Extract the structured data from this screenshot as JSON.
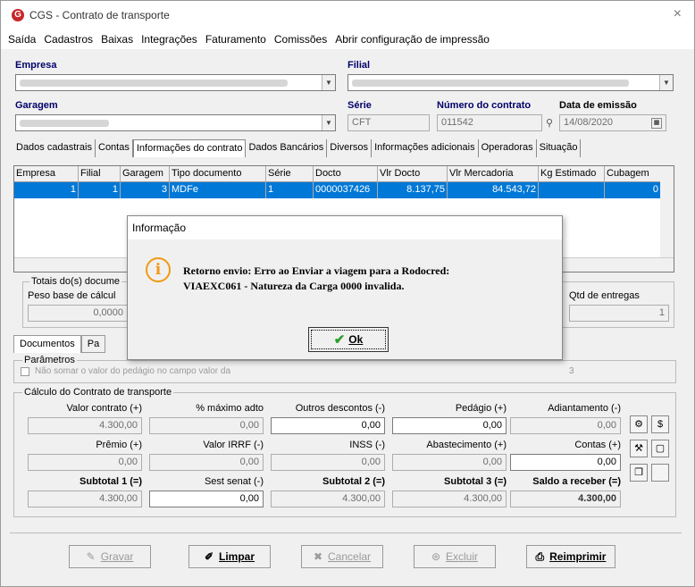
{
  "window": {
    "title": "CGS - Contrato de transporte",
    "logo": "G",
    "close_icon": "×"
  },
  "menu": [
    "Saída",
    "Cadastros",
    "Baixas",
    "Integrações",
    "Faturamento",
    "Comissões",
    "Abrir configuração de impressão"
  ],
  "fields": {
    "empresa_label": "Empresa",
    "filial_label": "Filial",
    "garagem_label": "Garagem",
    "serie_label": "Série",
    "serie_value": "CFT",
    "numero_label": "Número do contrato",
    "numero_value": "011542",
    "data_label": "Data de emissão",
    "data_value": "14/08/2020"
  },
  "tabs": [
    "Dados cadastrais",
    "Contas",
    "Informações do contrato",
    "Dados Bancários",
    "Diversos",
    "Informações adicionais",
    "Operadoras",
    "Situação"
  ],
  "grid": {
    "headers": [
      "Empresa",
      "Filial",
      "Garagem",
      "Tipo documento",
      "Série",
      "Docto",
      "Vlr Docto",
      "Vlr Mercadoria",
      "Kg Estimado",
      "Cubagem"
    ],
    "row": [
      "1",
      "1",
      "3",
      "MDFe",
      "1",
      "0000037426",
      "8.137,75",
      "84.543,72",
      "",
      "0"
    ]
  },
  "totals": {
    "group": "Totais do(s) docume",
    "peso_label": "Peso base de cálcul",
    "peso_value": "0,0000",
    "entregas_label": "Qtd de entregas",
    "entregas_value": "1"
  },
  "bottom_tabs": [
    "Documentos",
    "Pa"
  ],
  "params": {
    "group": "Parâmetros",
    "text": "Não somar o valor do pedágio no campo valor da",
    "tail": "3"
  },
  "calc": {
    "group": "Cálculo do Contrato de transporte",
    "row1_labels": [
      "Valor contrato (+)",
      "% máximo adto",
      "Outros descontos (-)",
      "Pedágio (+)",
      "Adiantamento (-)"
    ],
    "row1_values": [
      "4.300,00",
      "0,00",
      "0,00",
      "0,00",
      "0,00"
    ],
    "row2_labels": [
      "Prêmio (+)",
      "Valor IRRF (-)",
      "INSS (-)",
      "Abastecimento (+)",
      "Contas (+)"
    ],
    "row2_values": [
      "0,00",
      "0,00",
      "0,00",
      "0,00",
      "0,00"
    ],
    "row3_labels": [
      "Subtotal 1 (=)",
      "Sest senat (-)",
      "Subtotal 2 (=)",
      "Subtotal 3 (=)",
      "Saldo a receber (=)"
    ],
    "row3_values": [
      "4.300,00",
      "0,00",
      "4.300,00",
      "4.300,00",
      "4.300,00"
    ]
  },
  "buttons": {
    "gravar": "Gravar",
    "limpar": "Limpar",
    "cancelar": "Cancelar",
    "excluir": "Excluir",
    "reimprimir": "Reimprimir"
  },
  "dialog": {
    "title": "Informação",
    "icon": "i",
    "line1": "Retorno envio: Erro ao Enviar a viagem para a Rodocred:",
    "line2": "VIAEXC061 - Natureza da Carga 0000 invalida.",
    "ok": "Ok",
    "ok_icon": "✔"
  }
}
